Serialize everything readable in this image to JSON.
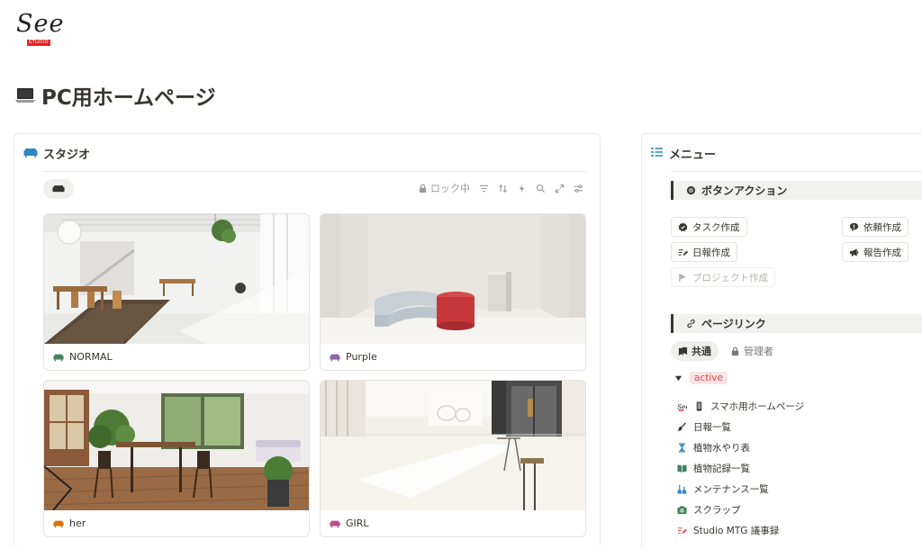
{
  "logo": {
    "text": "See",
    "sub": "STUDIO"
  },
  "page": {
    "title": "PC用ホームページ"
  },
  "studio": {
    "title": "スタジオ",
    "toolbar": {
      "lock_label": "ロック中"
    },
    "cards": [
      {
        "label": "NORMAL",
        "icon_color": "#448361"
      },
      {
        "label": "Purple",
        "icon_color": "#9065b0"
      },
      {
        "label": "her",
        "icon_color": "#d9730d"
      },
      {
        "label": "GIRL",
        "icon_color": "#c14c8a"
      }
    ]
  },
  "menu": {
    "title": "メニュー",
    "button_section": "ボタンアクション",
    "buttons": {
      "task": "タスク作成",
      "request": "依頼作成",
      "daily": "日報作成",
      "report": "報告作成",
      "project": "プロジェクト作成"
    },
    "links_section": "ページリンク",
    "tabs": {
      "common": "共通",
      "admin": "管理者"
    },
    "toggle": {
      "badge": "active"
    },
    "links": [
      {
        "label": "スマホ用ホームページ"
      },
      {
        "label": "日報一覧"
      },
      {
        "label": "植物水やり表"
      },
      {
        "label": "植物記録一覧"
      },
      {
        "label": "メンテナンス一覧"
      },
      {
        "label": "スクラップ"
      },
      {
        "label": "Studio MTG 議事録"
      }
    ]
  }
}
